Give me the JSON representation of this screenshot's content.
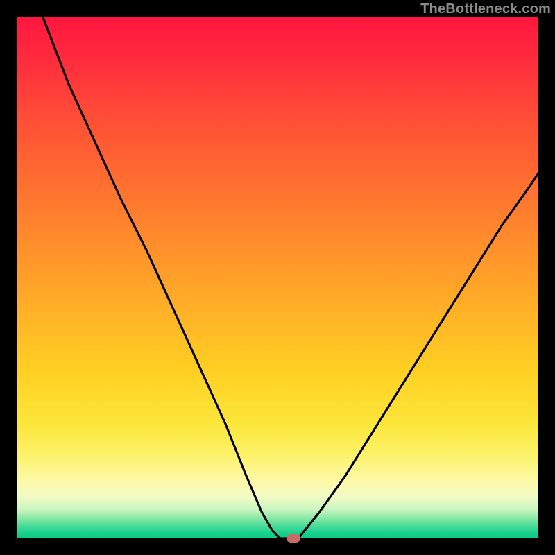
{
  "watermark": "TheBottleneck.com",
  "chart_data": {
    "type": "line",
    "title": "",
    "xlabel": "",
    "ylabel": "",
    "xlim": [
      0,
      100
    ],
    "ylim": [
      0,
      100
    ],
    "grid": false,
    "legend": false,
    "series": [
      {
        "name": "left-falling",
        "x": [
          5,
          10,
          15,
          20,
          25,
          30,
          35,
          40,
          44,
          47,
          49,
          50.5
        ],
        "y": [
          100,
          87,
          76,
          65,
          55,
          44,
          33,
          22,
          12,
          5,
          1.5,
          0
        ]
      },
      {
        "name": "valley-floor",
        "x": [
          50.5,
          54
        ],
        "y": [
          0,
          0
        ]
      },
      {
        "name": "right-rising",
        "x": [
          54,
          58,
          63,
          68,
          73,
          78,
          83,
          88,
          93,
          98,
          100
        ],
        "y": [
          0,
          5,
          12,
          20,
          28,
          36,
          44,
          52,
          60,
          67,
          70
        ]
      }
    ],
    "marker": {
      "x": 53,
      "y": 0,
      "shape": "rounded-rect",
      "color": "#c96a63"
    },
    "background_gradient": {
      "direction": "top-to-bottom",
      "stops": [
        {
          "pos": 0,
          "color": "#ff163e"
        },
        {
          "pos": 30,
          "color": "#ff6a31"
        },
        {
          "pos": 68,
          "color": "#ffd023"
        },
        {
          "pos": 89,
          "color": "#fdf9a8"
        },
        {
          "pos": 100,
          "color": "#0cc986"
        }
      ]
    }
  }
}
